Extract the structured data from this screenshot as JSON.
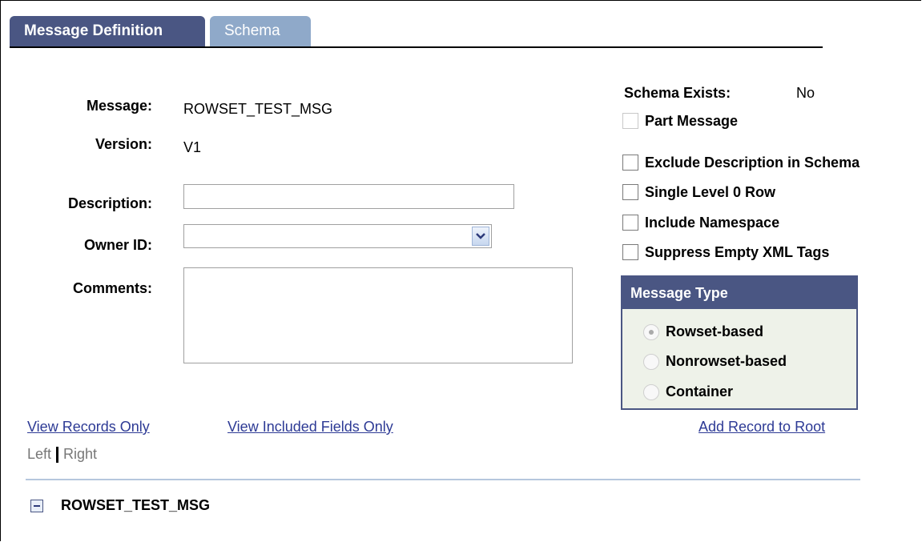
{
  "tabs": [
    {
      "label": "Message Definition"
    },
    {
      "label": "Schema"
    }
  ],
  "form": {
    "message_label": "Message:",
    "message_value": "ROWSET_TEST_MSG",
    "version_label": "Version:",
    "version_value": "V1",
    "description_label": "Description:",
    "description_value": "",
    "owner_label": "Owner ID:",
    "owner_value": "",
    "comments_label": "Comments:",
    "comments_value": ""
  },
  "schema": {
    "exists_label": "Schema Exists:",
    "exists_value": "No"
  },
  "checkboxes": [
    {
      "label": "Part Message",
      "checked": false,
      "disabled": true
    },
    {
      "label": "Exclude Description in Schema",
      "checked": false
    },
    {
      "label": "Single Level 0 Row",
      "checked": false
    },
    {
      "label": "Include Namespace",
      "checked": false
    },
    {
      "label": "Suppress Empty XML Tags",
      "checked": false
    }
  ],
  "message_type": {
    "title": "Message Type",
    "options": [
      {
        "label": "Rowset-based",
        "selected": true
      },
      {
        "label": "Nonrowset-based",
        "selected": false
      },
      {
        "label": "Container",
        "selected": false
      }
    ]
  },
  "links": {
    "view_records": "View Records Only",
    "view_fields": "View Included Fields Only",
    "add_record": "Add Record to Root"
  },
  "orientation": {
    "left": "Left",
    "right": "Right"
  },
  "tree": {
    "root": "ROWSET_TEST_MSG",
    "toggle_icon": "collapse-icon"
  },
  "colors": {
    "tab_active": "#4a5683",
    "tab_inactive": "#8fa9c9",
    "link": "#2d3a95"
  }
}
